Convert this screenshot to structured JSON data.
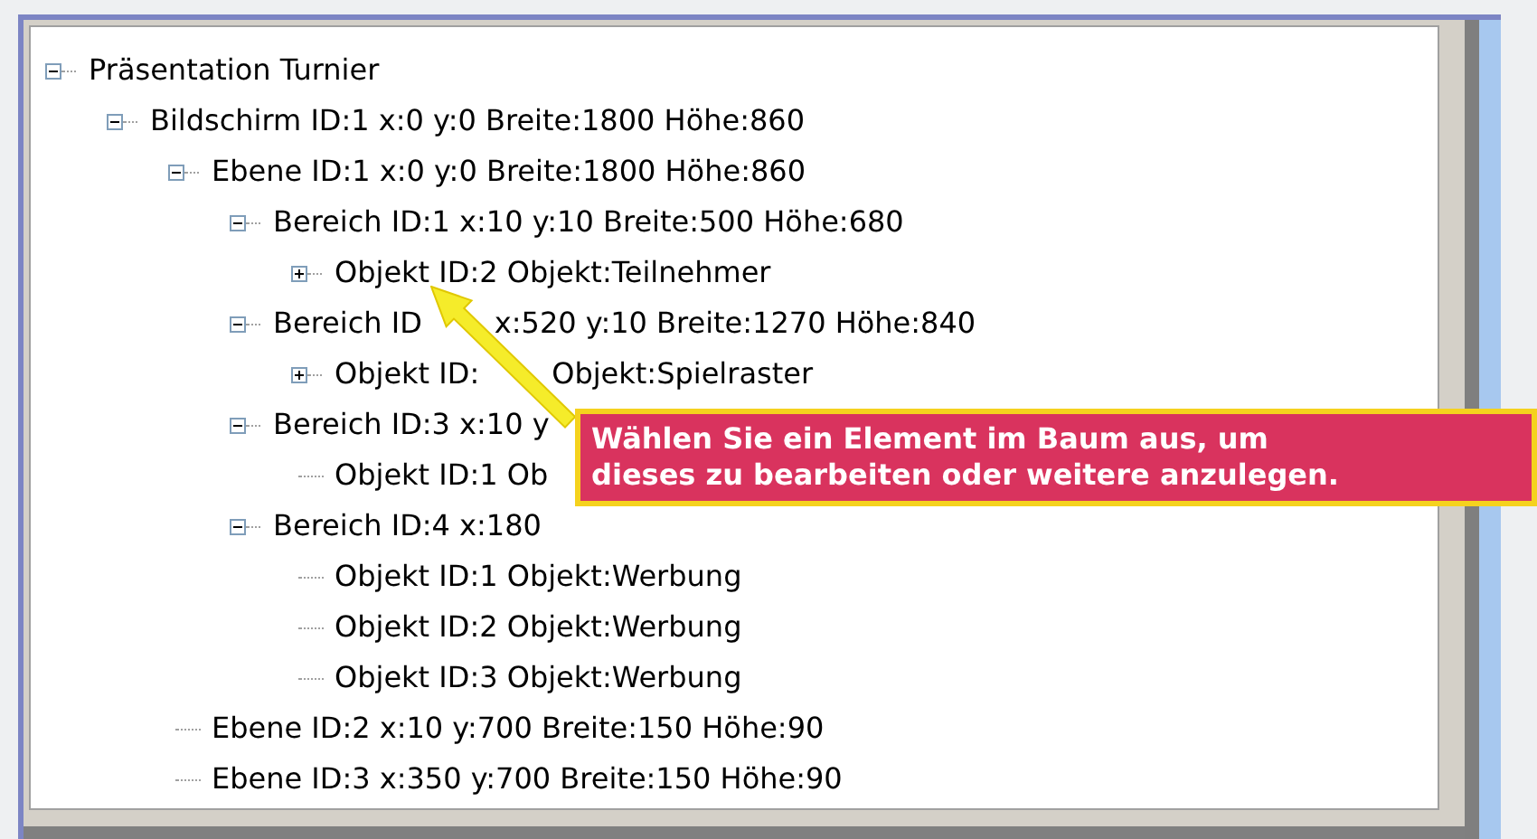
{
  "tree": [
    {
      "label": "Präsentation Turnier",
      "expanded": true,
      "children": [
        {
          "label": "Bildschirm ID:1 x:0 y:0 Breite:1800 Höhe:860",
          "expanded": true,
          "children": [
            {
              "label": "Ebene ID:1 x:0 y:0 Breite:1800 Höhe:860",
              "expanded": true,
              "children": [
                {
                  "label": "Bereich ID:1 x:10 y:10 Breite:500 Höhe:680",
                  "expanded": true,
                  "children": [
                    {
                      "label": "Objekt ID:2 Objekt:Teilnehmer",
                      "expanded": false
                    }
                  ]
                },
                {
                  "label": "Bereich ID",
                  "label_continued": "x:520 y:10 Breite:1270 Höhe:840",
                  "expanded": true,
                  "children": [
                    {
                      "label": "Objekt ID:",
                      "label_continued": "Objekt:Spielraster",
                      "expanded": false
                    }
                  ]
                },
                {
                  "label": "Bereich ID:3 x:10 y",
                  "expanded": true,
                  "children": [
                    {
                      "label": "Objekt ID:1 Ob"
                    }
                  ]
                },
                {
                  "label": "Bereich ID:4 x:180",
                  "expanded": true,
                  "children": [
                    {
                      "label": "Objekt ID:1 Objekt:Werbung"
                    },
                    {
                      "label": "Objekt ID:2 Objekt:Werbung"
                    },
                    {
                      "label": "Objekt ID:3 Objekt:Werbung"
                    }
                  ]
                }
              ]
            },
            {
              "label": "Ebene ID:2 x:10 y:700 Breite:150 Höhe:90"
            },
            {
              "label": "Ebene ID:3 x:350 y:700 Breite:150 Höhe:90"
            }
          ]
        }
      ]
    }
  ],
  "callout": {
    "lines": [
      "Wählen Sie ein Element im Baum aus, um",
      "dieses zu bearbeiten oder weitere anzulegen."
    ]
  }
}
